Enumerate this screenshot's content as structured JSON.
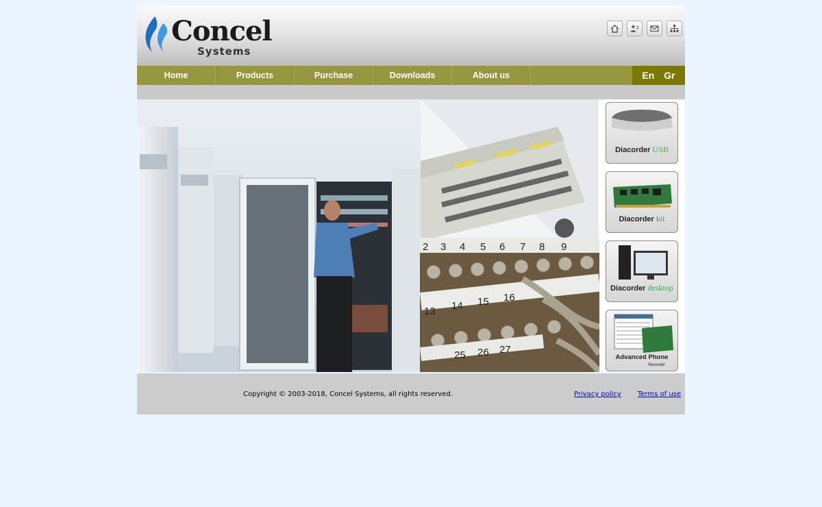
{
  "brand": {
    "name": "Concel",
    "tagline": "Systems"
  },
  "top_icons": [
    "home-icon",
    "contact-icon",
    "mail-icon",
    "sitemap-icon"
  ],
  "nav": {
    "items": [
      "Home",
      "Products",
      "Purchase",
      "Downloads",
      "About us"
    ],
    "languages": [
      "En",
      "Gr"
    ]
  },
  "products": [
    {
      "name": "Diacorder",
      "variant": "USB"
    },
    {
      "name": "Diacorder",
      "variant": "kit"
    },
    {
      "name": "Diacorder",
      "variant": "desktop"
    },
    {
      "name": "Advanced Phone",
      "subtitle": "Recorder"
    }
  ],
  "footer": {
    "copyright": "Copyright © 2003-2018, Concel Systems, all rights reserved.",
    "privacy": "Privacy policy",
    "terms": "Terms of use"
  },
  "colors": {
    "nav_bg": "#96963e",
    "lang_bg": "#7a7a00",
    "page_bg": "#eaf5ff",
    "product_accent": "#3aa65a"
  }
}
